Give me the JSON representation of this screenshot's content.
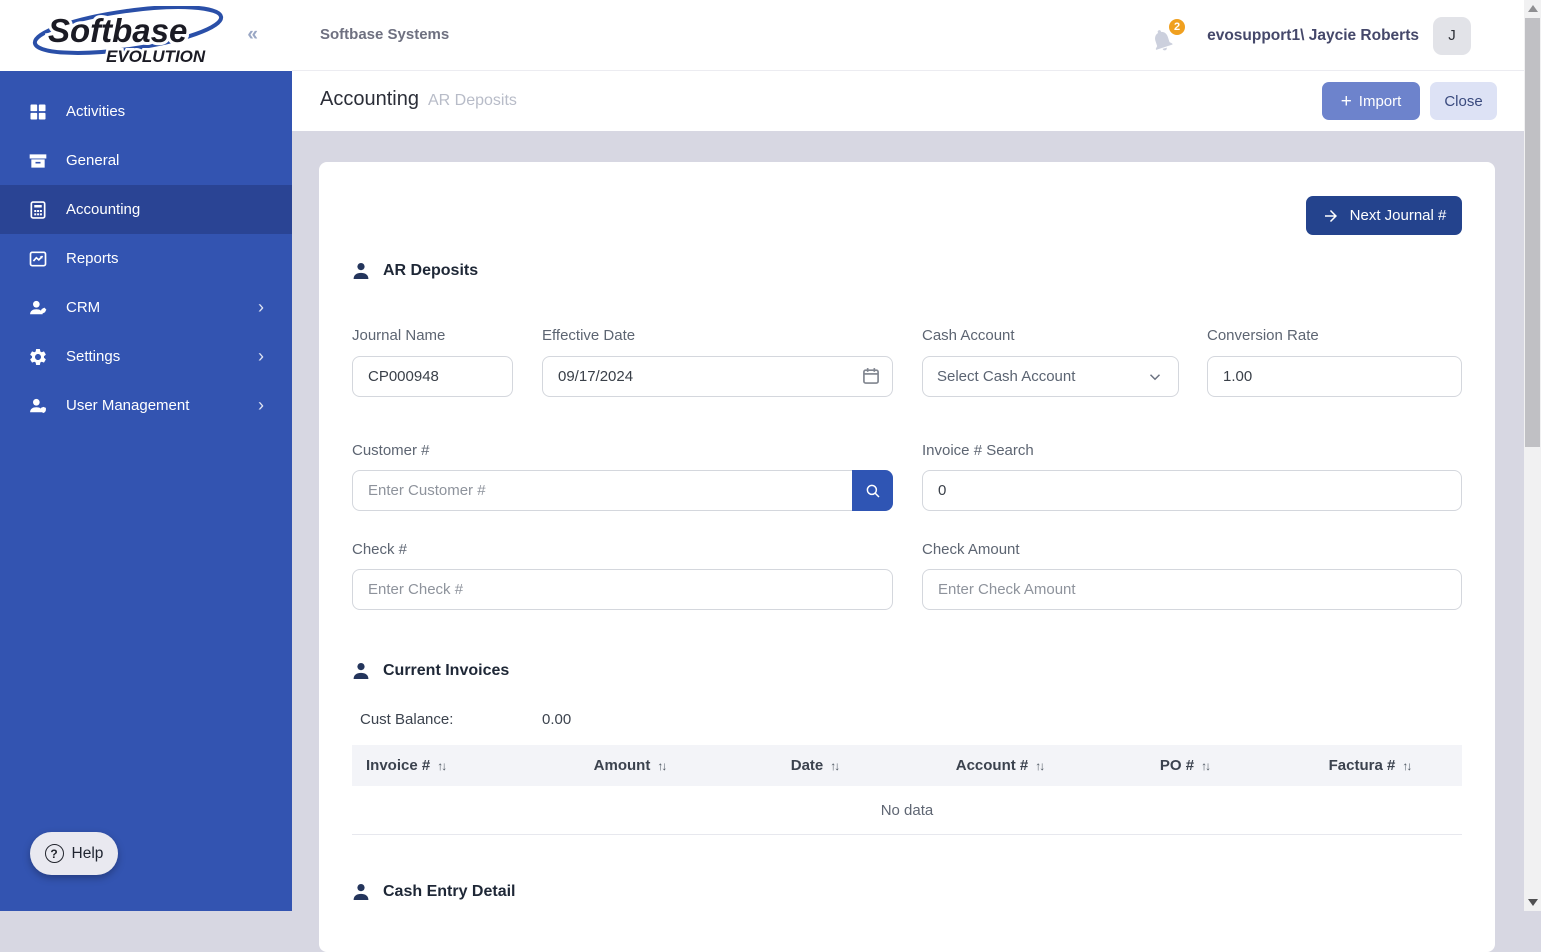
{
  "brand": {
    "name_top": "Softbase",
    "name_bottom": "EVOLUTION"
  },
  "icons": {
    "sort": "↑↓",
    "collapse": "«",
    "chevron_right": "›",
    "plus": "+",
    "question": "?"
  },
  "sidebar": {
    "items": [
      {
        "label": "Activities"
      },
      {
        "label": "General"
      },
      {
        "label": "Accounting"
      },
      {
        "label": "Reports"
      },
      {
        "label": "CRM"
      },
      {
        "label": "Settings"
      },
      {
        "label": "User Management"
      }
    ]
  },
  "topbar": {
    "company": "Softbase Systems",
    "notification_count": "2",
    "username": "evosupport1\\ Jaycie Roberts",
    "avatar_initial": "J"
  },
  "page_header": {
    "title": "Accounting",
    "subtitle": "AR Deposits",
    "import_label": "Import",
    "close_label": "Close"
  },
  "main": {
    "next_journal_label": "Next Journal #",
    "ar_deposits": {
      "section_title": "AR Deposits",
      "fields": {
        "journal_name": {
          "label": "Journal Name",
          "value": "CP000948"
        },
        "effective_date": {
          "label": "Effective Date",
          "value": "09/17/2024"
        },
        "cash_account": {
          "label": "Cash Account",
          "value": "Select Cash Account"
        },
        "conversion_rate": {
          "label": "Conversion Rate",
          "value": "1.00"
        },
        "customer": {
          "label": "Customer #",
          "placeholder": "Enter Customer #"
        },
        "invoice_search": {
          "label": "Invoice # Search",
          "value": "0"
        },
        "check_number": {
          "label": "Check #",
          "placeholder": "Enter Check #"
        },
        "check_amount": {
          "label": "Check Amount",
          "placeholder": "Enter Check Amount"
        }
      }
    },
    "current_invoices": {
      "section_title": "Current Invoices",
      "cust_balance_label": "Cust Balance:",
      "cust_balance_value": "0.00",
      "table": {
        "columns": [
          "Invoice #",
          "Amount",
          "Date",
          "Account #",
          "PO #",
          "Factura #"
        ],
        "empty_text": "No data"
      }
    },
    "cash_entry": {
      "section_title": "Cash Entry Detail"
    }
  },
  "help": {
    "label": "Help"
  },
  "colors": {
    "sidebar": "#3354b1",
    "sidebar_active": "#2a4494",
    "primary_button": "#24438d",
    "import_button": "#6d83cc",
    "close_button_bg": "#dde2f5",
    "search_button": "#2f55b4",
    "badge": "#f0a01f",
    "content_bg": "#d7d7e2"
  }
}
